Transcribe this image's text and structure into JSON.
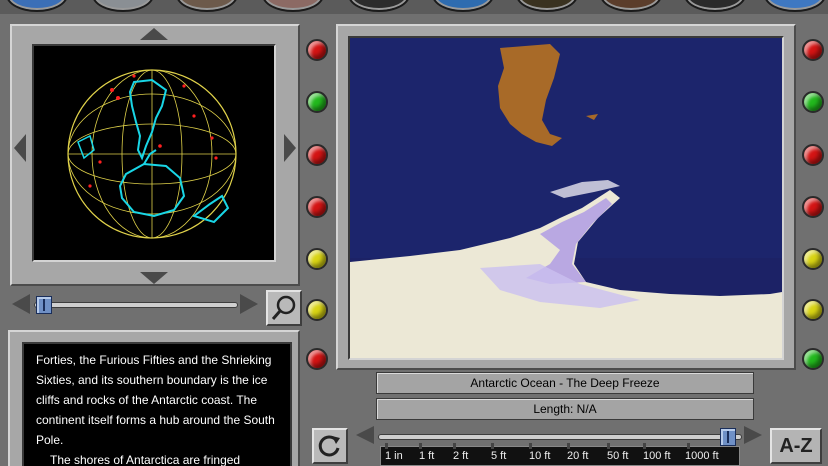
{
  "window": {
    "title": "Antarctic Ocean - The Deep Freeze"
  },
  "top_icons": [
    "topic-icon-1",
    "topic-icon-2",
    "topic-icon-3",
    "topic-icon-4",
    "topic-icon-5",
    "topic-icon-6",
    "topic-icon-7",
    "topic-icon-8",
    "topic-icon-9",
    "topic-icon-10"
  ],
  "globe": {
    "description_icon": "globe-map-icon",
    "colors": {
      "coast": "#19d6e6",
      "grid": "#e0d24a",
      "points": "#ff2020"
    }
  },
  "video": {
    "title": "Antarctic Ocean - The Deep Freeze",
    "length_label": "Length: N/A",
    "colors": {
      "ocean": "#1c2266",
      "ice": "#ece8d6",
      "land": "#a86a28",
      "ice_shadow": "#b9a8e2"
    }
  },
  "lights": {
    "left_column": [
      "red",
      "green",
      "red",
      "red",
      "yellow",
      "yellow",
      "red"
    ],
    "right_column": [
      "red",
      "green",
      "red",
      "red",
      "yellow",
      "yellow",
      "green"
    ]
  },
  "zoom_slider": {
    "level": 0.1
  },
  "timeline_slider": {
    "level": 0.97
  },
  "scale": {
    "labels": [
      "1 in",
      "1 ft",
      "2 ft",
      "5 ft",
      "10 ft",
      "20 ft",
      "50 ft",
      "100 ft",
      "1000 ft"
    ]
  },
  "article": {
    "paragraphs": [
      "Forties, the Furious Fifties and the Shrieking Sixties, and its southern boundary is the ice cliffs and rocks of the Antarctic coast. The continent itself forms a hub around the South Pole.",
      "The shores of Antarctica are fringed"
    ]
  },
  "buttons": {
    "az_label": "A-Z",
    "magnifier_icon": "magnifier-icon",
    "replay_icon": "replay-icon"
  }
}
